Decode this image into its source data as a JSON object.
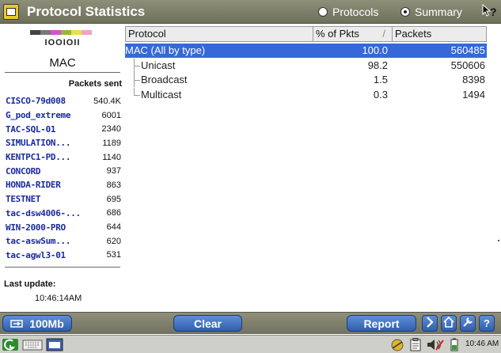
{
  "window": {
    "title": "Protocol Statistics",
    "view_options": [
      {
        "label": "Protocols",
        "selected": false
      },
      {
        "label": "Summary",
        "selected": true
      }
    ],
    "help_icon": "context-help-icon"
  },
  "left_panel": {
    "mac_code": "IOOIOII",
    "mac_label": "MAC",
    "color_bar": [
      "#444444",
      "#777777",
      "#d94fd0",
      "#9bb53a",
      "#e7e04a",
      "#f2a1c4"
    ],
    "packets_sent_header": "Packets sent",
    "hosts": [
      {
        "name": "CISCO-79d008",
        "count": "540.4K"
      },
      {
        "name": "G_pod_extreme",
        "count": "6001"
      },
      {
        "name": "TAC-SQL-01",
        "count": "2340"
      },
      {
        "name": "SIMULATION...",
        "count": "1189"
      },
      {
        "name": "KENTPC1-PD...",
        "count": "1140"
      },
      {
        "name": "CONCORD",
        "count": "937"
      },
      {
        "name": "HONDA-RIDER",
        "count": "863"
      },
      {
        "name": "TESTNET",
        "count": "695"
      },
      {
        "name": "tac-dsw4006-...",
        "count": "686"
      },
      {
        "name": "WIN-2000-PRO",
        "count": "644"
      },
      {
        "name": "tac-aswSum...",
        "count": "620"
      },
      {
        "name": "tac-agwl3-01",
        "count": "531"
      }
    ],
    "last_update_label": "Last update:",
    "last_update_value": "10:46:14AM"
  },
  "table": {
    "columns": [
      "Protocol",
      "% of Pkts",
      "Packets"
    ],
    "rows": [
      {
        "protocol": "MAC (All by type)",
        "pct": "100.0",
        "packets": "560485",
        "selected": true,
        "indent": false
      },
      {
        "protocol": "Unicast",
        "pct": "98.2",
        "packets": "550606",
        "selected": false,
        "indent": true
      },
      {
        "protocol": "Broadcast",
        "pct": "1.5",
        "packets": "8398",
        "selected": false,
        "indent": true
      },
      {
        "protocol": "Multicast",
        "pct": "0.3",
        "packets": "1494",
        "selected": false,
        "indent": true
      }
    ]
  },
  "toolbar": {
    "speed_label": "100Mb",
    "clear_label": "Clear",
    "report_label": "Report",
    "icons": [
      "transfer-icon",
      "home-icon",
      "tools-icon",
      "help-icon"
    ]
  },
  "taskbar": {
    "clock": "10:46 AM",
    "items": [
      "start-icon",
      "keyboard-icon",
      "window-icon",
      "network-icon",
      "clipboard-icon",
      "volume-icon",
      "battery-icon"
    ]
  },
  "colors": {
    "titlebar": "#7f8069",
    "selected_row": "#3569d9",
    "button_blue": "#2f5fae",
    "host_link": "#1a2a9c"
  }
}
